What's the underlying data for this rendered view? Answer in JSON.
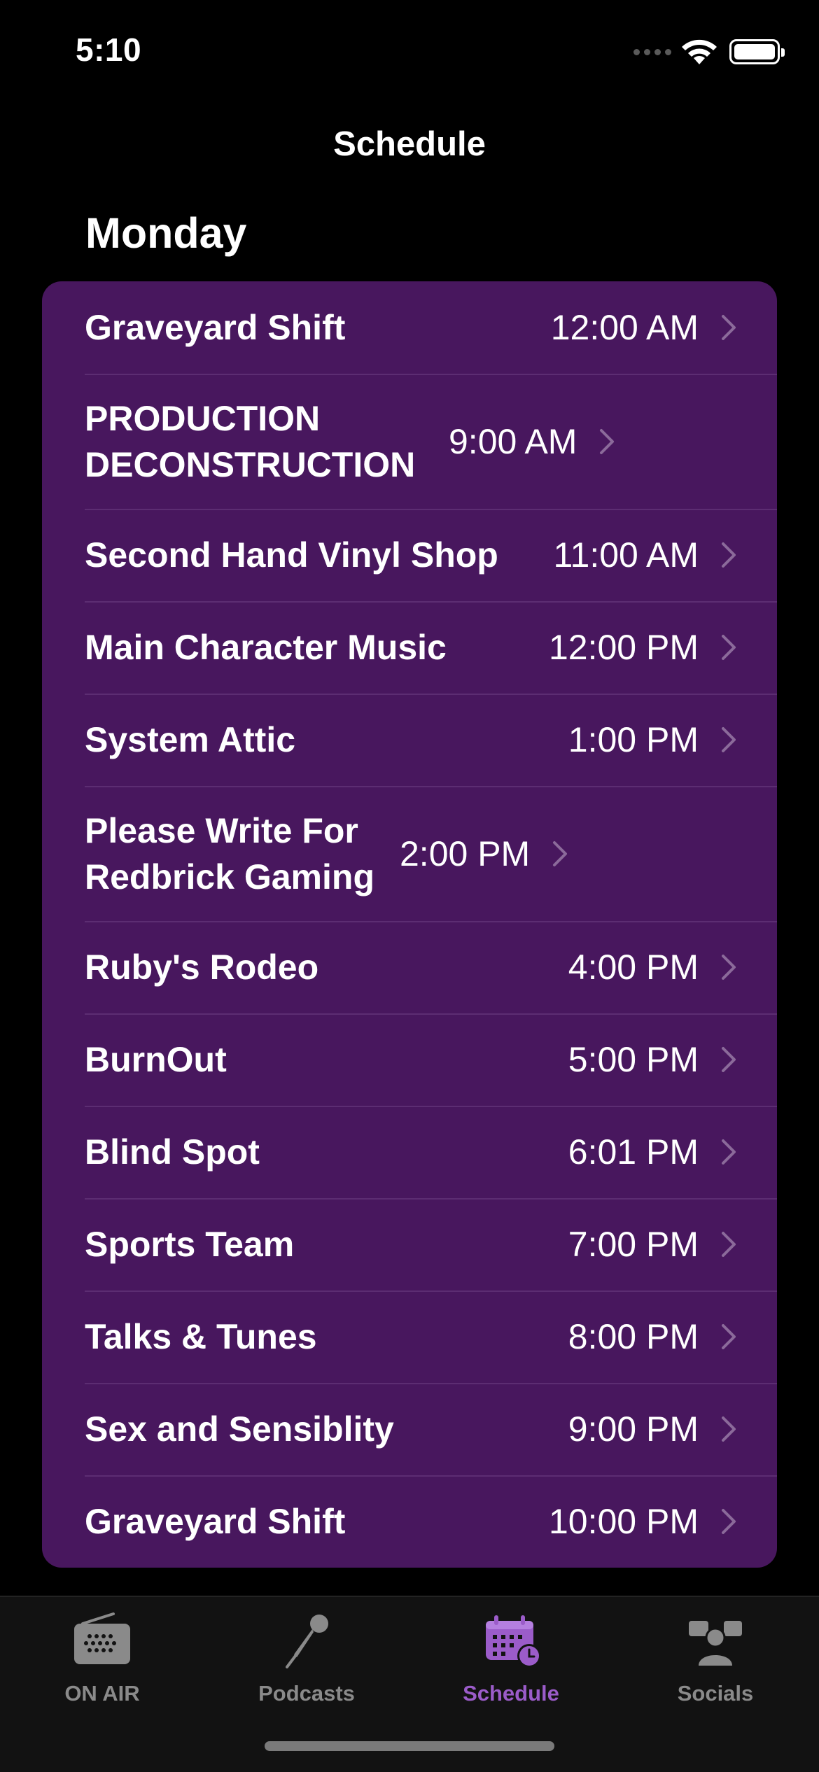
{
  "status_bar": {
    "time": "5:10"
  },
  "nav": {
    "title": "Schedule"
  },
  "section": {
    "day": "Monday"
  },
  "shows": [
    {
      "title": "Graveyard Shift",
      "time": "12:00 AM"
    },
    {
      "title": "PRODUCTION DECONSTRUCTION",
      "time": "9:00 AM"
    },
    {
      "title": "Second Hand Vinyl Shop",
      "time": "11:00 AM"
    },
    {
      "title": "Main Character Music",
      "time": "12:00 PM"
    },
    {
      "title": "System Attic",
      "time": "1:00 PM"
    },
    {
      "title": "Please Write For Redbrick Gaming",
      "time": "2:00 PM"
    },
    {
      "title": "Ruby's Rodeo",
      "time": "4:00 PM"
    },
    {
      "title": "BurnOut",
      "time": "5:00 PM"
    },
    {
      "title": "Blind Spot",
      "time": "6:01 PM"
    },
    {
      "title": "Sports Team",
      "time": "7:00 PM"
    },
    {
      "title": "Talks & Tunes",
      "time": "8:00 PM"
    },
    {
      "title": "Sex and Sensiblity",
      "time": "9:00 PM"
    },
    {
      "title": "Graveyard Shift",
      "time": "10:00 PM"
    }
  ],
  "tabs": [
    {
      "label": "ON AIR",
      "icon": "radio-icon",
      "active": false
    },
    {
      "label": "Podcasts",
      "icon": "microphone-icon",
      "active": false
    },
    {
      "label": "Schedule",
      "icon": "calendar-clock-icon",
      "active": true
    },
    {
      "label": "Socials",
      "icon": "people-icon",
      "active": false
    }
  ],
  "colors": {
    "list_bg": "#48175e",
    "accent": "#9b5cc9",
    "inactive": "#8a8a8a"
  }
}
